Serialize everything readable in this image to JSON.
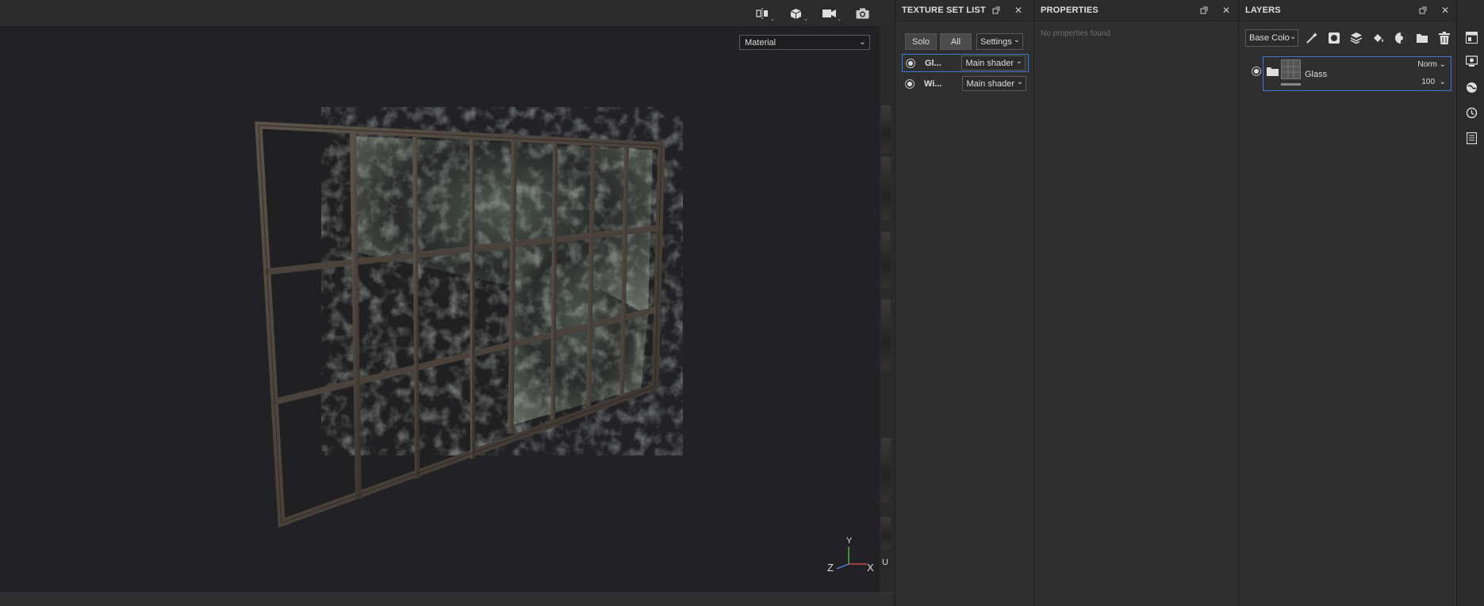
{
  "viewport": {
    "shader_mode": "Material",
    "axis": {
      "x": "X",
      "y": "Y",
      "z": "Z",
      "u": "U"
    },
    "tools": [
      "symmetry-icon",
      "cube-view-icon",
      "camera-icon",
      "screenshot-icon"
    ]
  },
  "texture_set_list": {
    "title": "TEXTURE SET LIST",
    "solo_label": "Solo",
    "all_label": "All",
    "settings_label": "Settings",
    "sets": [
      {
        "name": "Gl...",
        "shader": "Main shader",
        "selected": true
      },
      {
        "name": "Wi...",
        "shader": "Main shader",
        "selected": false
      }
    ]
  },
  "properties": {
    "title": "PROPERTIES",
    "empty_text": "No properties found"
  },
  "layers": {
    "title": "LAYERS",
    "channel": "Base Colo",
    "items": [
      {
        "name": "Glass",
        "blend": "Norm",
        "opacity": "100"
      }
    ]
  },
  "colors": {
    "accent": "#3d7bd3",
    "panel_bg": "#2f2f2f",
    "viewport_bg": "#222226"
  }
}
